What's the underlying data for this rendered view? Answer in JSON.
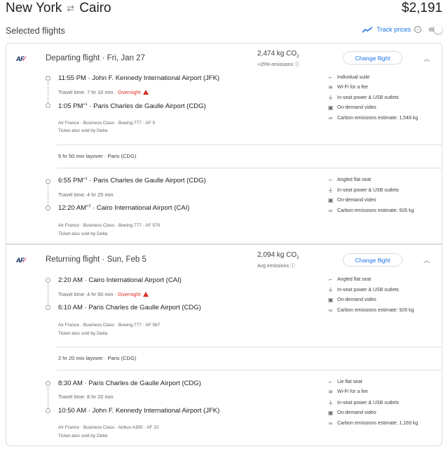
{
  "header": {
    "origin": "New York",
    "destination": "Cairo",
    "swap_icon": "swap-arrows-icon",
    "price": "$2,191"
  },
  "selected": {
    "title": "Selected flights",
    "track_label": "Track prices",
    "track_enabled": false
  },
  "departing": {
    "airline": "AF",
    "title": "Departing flight",
    "date": "Fri, Jan 27",
    "co2": "2,474 kg CO",
    "co2_sub": "2",
    "emissions": "+25% emissions",
    "change_label": "Change flight",
    "segments": [
      {
        "dep_time": "11:55 PM",
        "dep_sup": "",
        "dep_airport": "John F. Kennedy International Airport (JFK)",
        "travel": "Travel time: 7 hr 10 min",
        "overnight": "Overnight",
        "arr_time": "1:05 PM",
        "arr_sup": "+1",
        "arr_airport": "Paris Charles de Gaulle Airport (CDG)",
        "meta": "Air France · Business Class · Boeing 777 · AF 9",
        "sold_by": "Ticket also sold by Delta",
        "amenities": [
          "Individual suite",
          "Wi-Fi for a fee",
          "In-seat power & USB outlets",
          "On-demand video",
          "Carbon emissions estimate: 1,548 kg"
        ]
      },
      {
        "dep_time": "6:55 PM",
        "dep_sup": "+1",
        "dep_airport": "Paris Charles de Gaulle Airport (CDG)",
        "travel": "Travel time: 4 hr 25 min",
        "overnight": "",
        "arr_time": "12:20 AM",
        "arr_sup": "+2",
        "arr_airport": "Cairo International Airport (CAI)",
        "meta": "Air France · Business Class · Boeing 777 · AF 570",
        "sold_by": "Ticket also sold by Delta",
        "amenities": [
          "Angled flat seat",
          "In-seat power & USB outlets",
          "On-demand video",
          "Carbon emissions estimate: 926 kg"
        ]
      }
    ],
    "layover": "5 hr 50 min layover · Paris (CDG)"
  },
  "returning": {
    "airline": "AF",
    "title": "Returning flight",
    "date": "Sun, Feb 5",
    "co2": "2,094 kg CO",
    "co2_sub": "2",
    "emissions": "Avg emissions",
    "change_label": "Change flight",
    "segments": [
      {
        "dep_time": "2:20 AM",
        "dep_sup": "",
        "dep_airport": "Cairo International Airport (CAI)",
        "travel": "Travel time: 4 hr 50 min",
        "overnight": "Overnight",
        "arr_time": "6:10 AM",
        "arr_sup": "",
        "arr_airport": "Paris Charles de Gaulle Airport (CDG)",
        "meta": "Air France · Business Class · Boeing 777 · AF 567",
        "sold_by": "Ticket also sold by Delta",
        "amenities": [
          "Angled flat seat",
          "In-seat power & USB outlets",
          "On-demand video",
          "Carbon emissions estimate: 926 kg"
        ]
      },
      {
        "dep_time": "8:30 AM",
        "dep_sup": "",
        "dep_airport": "Paris Charles de Gaulle Airport (CDG)",
        "travel": "Travel time: 8 hr 20 min",
        "overnight": "",
        "arr_time": "10:50 AM",
        "arr_sup": "",
        "arr_airport": "John F. Kennedy International Airport (JFK)",
        "meta": "Air France · Business Class · Airbus A350 · AF 22",
        "sold_by": "Ticket also sold by Delta",
        "amenities": [
          "Lie flat seat",
          "Wi-Fi for a fee",
          "In-seat power & USB outlets",
          "On-demand video",
          "Carbon emissions estimate: 1,169 kg"
        ]
      }
    ],
    "layover": "2 hr 20 min layover · Paris (CDG)"
  },
  "colors": {
    "accent": "#1a73e8",
    "warning": "#d93025",
    "brand_navy": "#002157",
    "brand_red": "#e30613"
  }
}
